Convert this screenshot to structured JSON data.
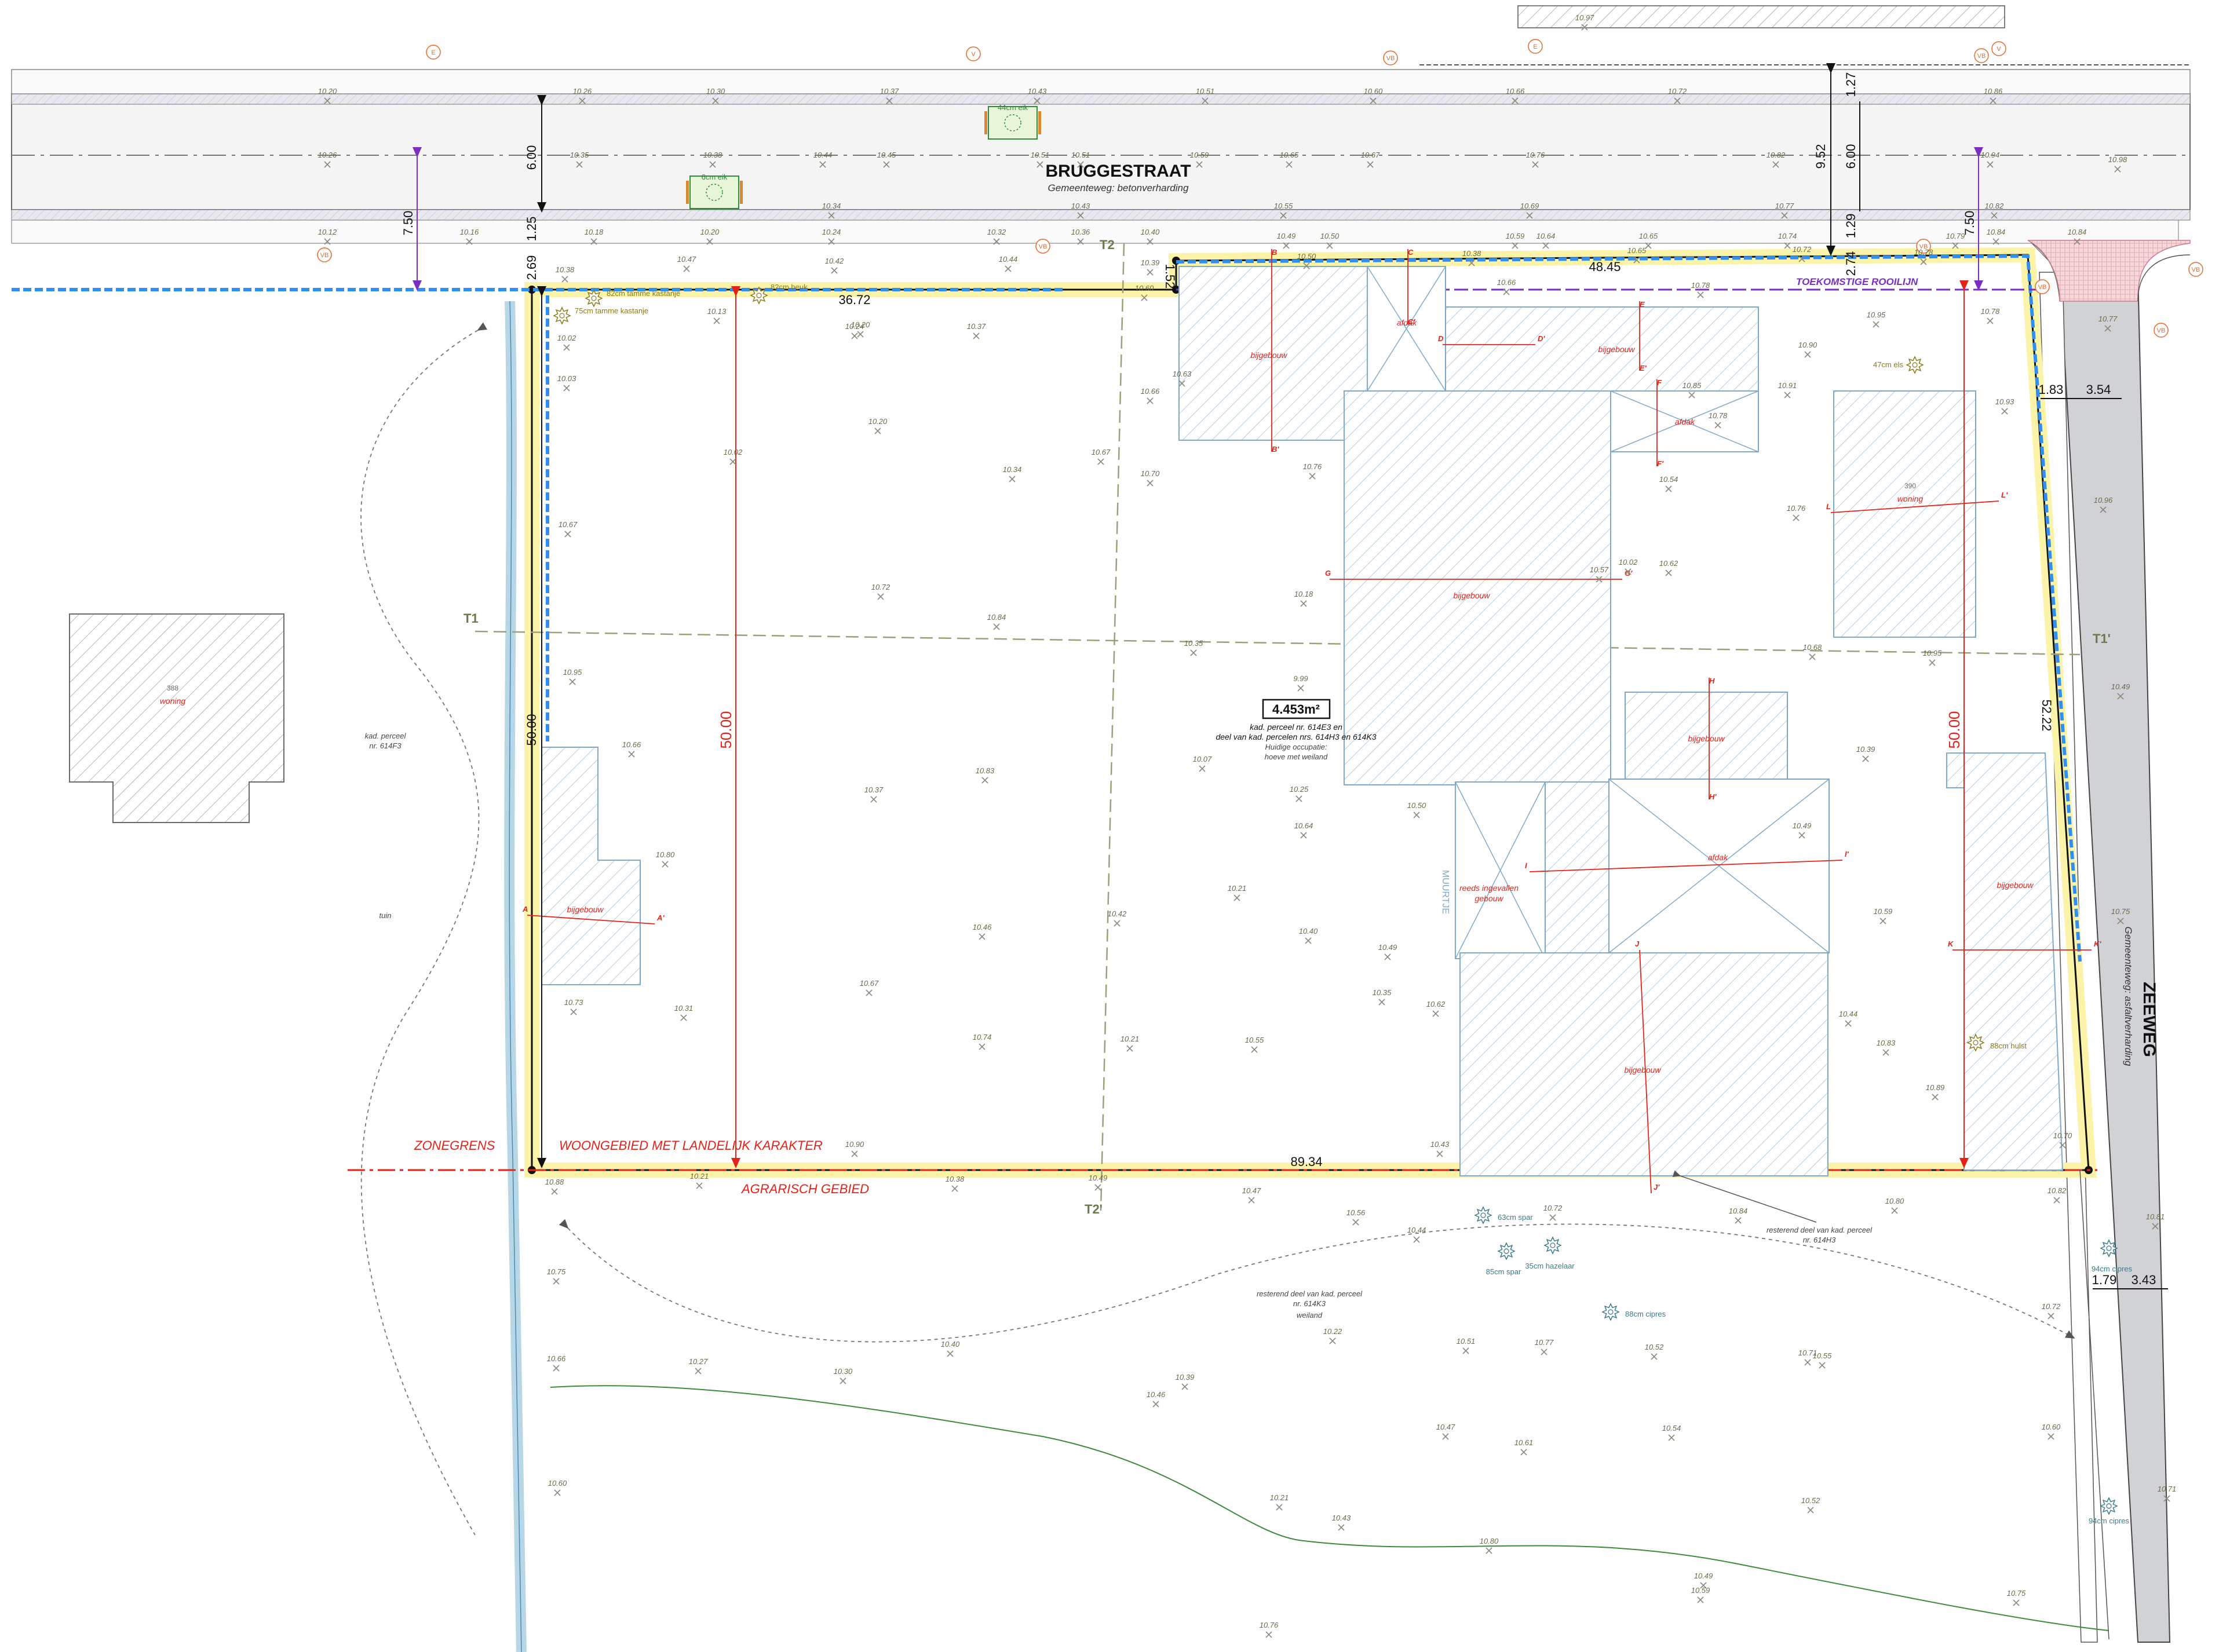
{
  "streets": {
    "bruggestraat_name": "BRUGGESTRAAT",
    "bruggestraat_desc": "Gemeenteweg: betonverharding",
    "zeeweg_name": "ZEEWEG",
    "zeeweg_desc": "Gemeenteweg: asfaltverharding"
  },
  "labels": {
    "future_line": "TOEKOMSTIGE ROOILIJN",
    "zonegrens": "ZONEGRENS",
    "woongebied": "WOONGEBIED MET LANDELIJK KARAKTER",
    "agrarisch": "AGRARISCH GEBIED",
    "area": "4.453m²",
    "parcel_1": "kad. perceel nr. 614E3 en",
    "parcel_2": "deel van kad. percelen nrs. 614H3 en 614K3",
    "parcel_3": "Huidige occupatie:",
    "parcel_4": "hoeve met weiland",
    "left_parcel_1": "kad. perceel",
    "left_parcel_2": "nr. 614F3",
    "tuin": "tuin",
    "rest_1": "resterend deel van kad. perceel",
    "rest_2": "nr. 614K3",
    "rest_3": "weiland",
    "rest2_1": "resterend deel van kad. perceel",
    "rest2_2": "nr. 614H3",
    "muurtje": "MUURTJE",
    "ingevallen_1": "reeds ingevallen",
    "ingevallen_2": "gebouw",
    "bijgebouw": "bijgebouw",
    "woning": "woning",
    "afdak": "afdak",
    "house_no_left": "388",
    "house_no_right": "390",
    "T1": "T1",
    "T1p": "T1'",
    "T2": "T2",
    "T2p": "T2'"
  },
  "dimensions": {
    "d_7_50_left": "7.50",
    "d_6_00_left": "6.00",
    "d_1_25": "1.25",
    "d_2_69": "2.69",
    "d_36_72": "36.72",
    "d_48_45": "48.45",
    "d_1_52": "1.52",
    "d_50_00_a": "50.00",
    "d_50_00_b": "50.00",
    "d_50_00_c": "50.00",
    "d_89_34": "89.34",
    "d_52_22": "52.22",
    "d_9_52": "9.52",
    "d_6_00_right": "6.00",
    "d_1_27": "1.27",
    "d_1_29": "1.29",
    "d_2_74": "2.74",
    "d_7_50_right": "7.50",
    "d_1_83": "1.83",
    "d_3_54": "3.54",
    "d_1_79": "1.79",
    "d_3_43": "3.43"
  },
  "trees": [
    {
      "label": "44cm eik",
      "color": "#2e8b3a"
    },
    {
      "label": "6cm eik",
      "color": "#2e8b3a"
    },
    {
      "label": "82cm tamme kastanje",
      "color": "#8a7a1a"
    },
    {
      "label": "82cm beuk",
      "color": "#8a7a1a"
    },
    {
      "label": "75cm tamme kastanje",
      "color": "#8a7a1a"
    },
    {
      "label": "47cm els",
      "color": "#8a7a1a"
    },
    {
      "label": "88cm hulst",
      "color": "#8a7a1a"
    },
    {
      "label": "63cm spar",
      "color": "#3a7a8a"
    },
    {
      "label": "85cm spar",
      "color": "#3a7a8a"
    },
    {
      "label": "35cm hazelaar",
      "color": "#3a7a8a"
    },
    {
      "label": "88cm cipres",
      "color": "#3a7a8a"
    },
    {
      "label": "94cm cipres",
      "color": "#3a7a8a"
    },
    {
      "label": "94cm cipres",
      "color": "#3a7a8a"
    }
  ],
  "symbols": [
    "E",
    "V",
    "VB",
    "E",
    "VB",
    "V",
    "VB",
    "VB",
    "VB",
    "VB",
    "VB",
    "VB"
  ],
  "section_marks": [
    "A",
    "A'",
    "B",
    "B'",
    "C",
    "C'",
    "D",
    "D'",
    "E",
    "E'",
    "F",
    "F'",
    "G",
    "G'",
    "H",
    "H'",
    "I",
    "I'",
    "J",
    "J'",
    "K",
    "K'",
    "L",
    "L'"
  ],
  "spot_heights": [
    "10.97",
    "10.20",
    "10.26",
    "10.30",
    "10.37",
    "10.43",
    "10.51",
    "10.60",
    "10.66",
    "10.72",
    "10.86",
    "10.26",
    "10.35",
    "10.38",
    "10.44",
    "10.45",
    "10.51",
    "10.51",
    "10.59",
    "10.65",
    "10.67",
    "10.76",
    "10.82",
    "10.94",
    "10.98",
    "10.34",
    "10.43",
    "10.55",
    "10.69",
    "10.77",
    "10.82",
    "10.12",
    "10.16",
    "10.18",
    "10.20",
    "10.24",
    "10.32",
    "10.36",
    "10.40",
    "10.49",
    "10.50",
    "10.59",
    "10.64",
    "10.65",
    "10.74",
    "10.79",
    "10.84",
    "10.84",
    "10.38",
    "10.47",
    "10.42",
    "10.44",
    "10.39",
    "10.50",
    "10.38",
    "10.65",
    "10.72",
    "10.78",
    "10.60",
    "10.66",
    "10.78",
    "10.95",
    "10.78",
    "10.77",
    "10.02",
    "10.13",
    "10.20",
    "10.24",
    "10.37",
    "10.90",
    "10.03",
    "10.66",
    "10.63",
    "10.85",
    "10.78",
    "10.91",
    "10.93",
    "10.20",
    "10.02",
    "10.67",
    "10.34",
    "10.70",
    "10.76",
    "10.54",
    "10.76",
    "10.96",
    "10.67",
    "10.02",
    "10.62",
    "10.57",
    "10.72",
    "10.18",
    "10.84",
    "10.35",
    "10.68",
    "10.95",
    "10.95",
    "9.99",
    "10.49",
    "10.66",
    "10.07",
    "10.39",
    "10.83",
    "10.37",
    "10.25",
    "10.50",
    "10.64",
    "10.49",
    "10.80",
    "10.21",
    "10.42",
    "10.46",
    "10.40",
    "10.49",
    "10.59",
    "10.75",
    "10.67",
    "10.35",
    "10.62",
    "10.73",
    "10.31",
    "10.21",
    "10.55",
    "10.74",
    "10.44",
    "10.83",
    "10.89",
    "10.90",
    "10.43",
    "10.70",
    "10.88",
    "10.21",
    "10.38",
    "10.49",
    "10.47",
    "10.56",
    "10.44",
    "10.72",
    "10.84",
    "10.80",
    "10.82",
    "10.81",
    "10.75",
    "10.22",
    "10.40",
    "10.51",
    "10.77",
    "10.52",
    "10.71",
    "10.55",
    "10.72",
    "10.66",
    "10.27",
    "10.30",
    "10.39",
    "10.46",
    "10.47",
    "10.61",
    "10.54",
    "10.60",
    "10.60",
    "10.21",
    "10.43",
    "10.52",
    "10.71",
    "10.80",
    "10.49",
    "10.59",
    "10.75",
    "10.76"
  ]
}
